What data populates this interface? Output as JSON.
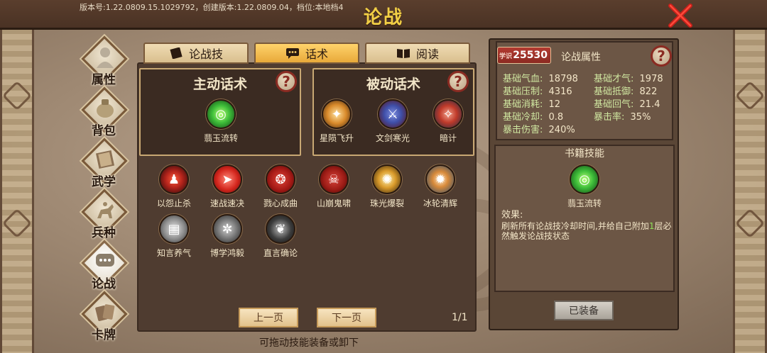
{
  "header": {
    "version_text": "版本号:1.22.0809.15.1029792，创建版本:1.22.0809.04，档位:本地档4",
    "title": "论战",
    "close_icon": "close-x-icon"
  },
  "nav": {
    "items": [
      {
        "label": "属性",
        "icon": "person-icon",
        "active": false
      },
      {
        "label": "背包",
        "icon": "bag-icon",
        "active": false
      },
      {
        "label": "武学",
        "icon": "book-icon",
        "active": false
      },
      {
        "label": "兵种",
        "icon": "cavalry-icon",
        "active": false
      },
      {
        "label": "论战",
        "icon": "chat-bubble-icon",
        "active": true
      },
      {
        "label": "卡牌",
        "icon": "cards-icon",
        "active": false
      }
    ]
  },
  "tabs": [
    {
      "label": "论战技",
      "icon": "book-icon",
      "active": false
    },
    {
      "label": "话术",
      "icon": "chat-icon",
      "active": true
    },
    {
      "label": "阅读",
      "icon": "open-book-icon",
      "active": false
    }
  ],
  "active_skills": {
    "title": "主动话术",
    "items": [
      {
        "name": "翡玉流转",
        "color": "#3fbf3a"
      }
    ]
  },
  "passive_skills": {
    "title": "被动话术",
    "items": [
      {
        "name": "星陨飞升",
        "color": "#d8892a"
      },
      {
        "name": "文剑寒光",
        "color": "#3f4fa8"
      },
      {
        "name": "暗计",
        "color": "#c03a2a"
      }
    ]
  },
  "skill_pool": [
    {
      "name": "以怨止杀",
      "color": "#b2231b"
    },
    {
      "name": "速战速决",
      "color": "#d4261d"
    },
    {
      "name": "戮心成曲",
      "color": "#a61a16"
    },
    {
      "name": "山崩鬼啸",
      "color": "#9d1c16"
    },
    {
      "name": "珠光爆裂",
      "color": "#d99a2a"
    },
    {
      "name": "冰轮清辉",
      "color": "#d88a3a"
    },
    {
      "name": "知言养气",
      "color": "#8a8a8a"
    },
    {
      "name": "博学鸿毅",
      "color": "#6f6f6f"
    },
    {
      "name": "直言确论",
      "color": "#3c3c3c"
    }
  ],
  "pagination": {
    "prev_label": "上一页",
    "next_label": "下一页",
    "page_text": "1/1"
  },
  "hint": "可拖动技能装备或卸下",
  "attributes": {
    "xueshi_tag": "学识",
    "xueshi_value": "25530",
    "title": "论战属性",
    "stats_left": [
      {
        "label": "基础气血:",
        "value": "18798"
      },
      {
        "label": "基础压制:",
        "value": "4316"
      },
      {
        "label": "基础消耗:",
        "value": "12"
      },
      {
        "label": "基础冷却:",
        "value": "0.8"
      },
      {
        "label": "暴击伤害:",
        "value": "240%"
      }
    ],
    "stats_right": [
      {
        "label": "基础才气:",
        "value": "1978"
      },
      {
        "label": "基础抵御:",
        "value": "822"
      },
      {
        "label": "基础回气:",
        "value": "21.4"
      },
      {
        "label": "暴击率:",
        "value": "35%"
      }
    ]
  },
  "book_skill": {
    "title": "书籍技能",
    "skill_name": "翡玉流转",
    "effect_label": "效果:",
    "effect_text_1": "刷新所有论战技冷却时间,并给自己附加",
    "effect_highlight": "1",
    "effect_text_2": "层必然触发论战技状态",
    "equipped_label": "已装备"
  }
}
